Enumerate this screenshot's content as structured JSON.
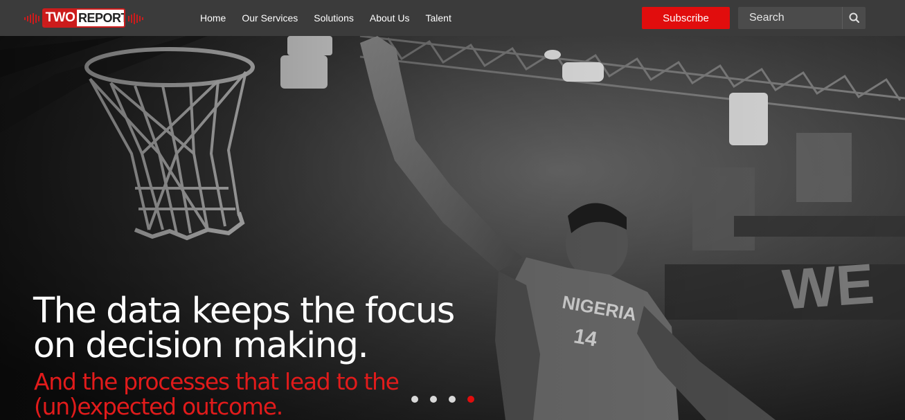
{
  "brand": {
    "logo_text_two": "TWO",
    "logo_text_report": "REPORT",
    "logo_icon": "sound-waves-icon",
    "accent_color": "#e10d0d"
  },
  "nav": {
    "items": [
      {
        "label": "Home"
      },
      {
        "label": "Our Services"
      },
      {
        "label": "Solutions"
      },
      {
        "label": "About Us"
      },
      {
        "label": "Talent"
      }
    ]
  },
  "header": {
    "subscribe_label": "Subscribe",
    "search_placeholder": "Search",
    "search_value": "",
    "search_icon": "magnifier-icon"
  },
  "hero": {
    "headline": "The data keeps the focus on decision making.",
    "subheadline": "And the processes that lead to the (un)expected outcome.",
    "slide_count": 4,
    "active_slide": 4
  }
}
